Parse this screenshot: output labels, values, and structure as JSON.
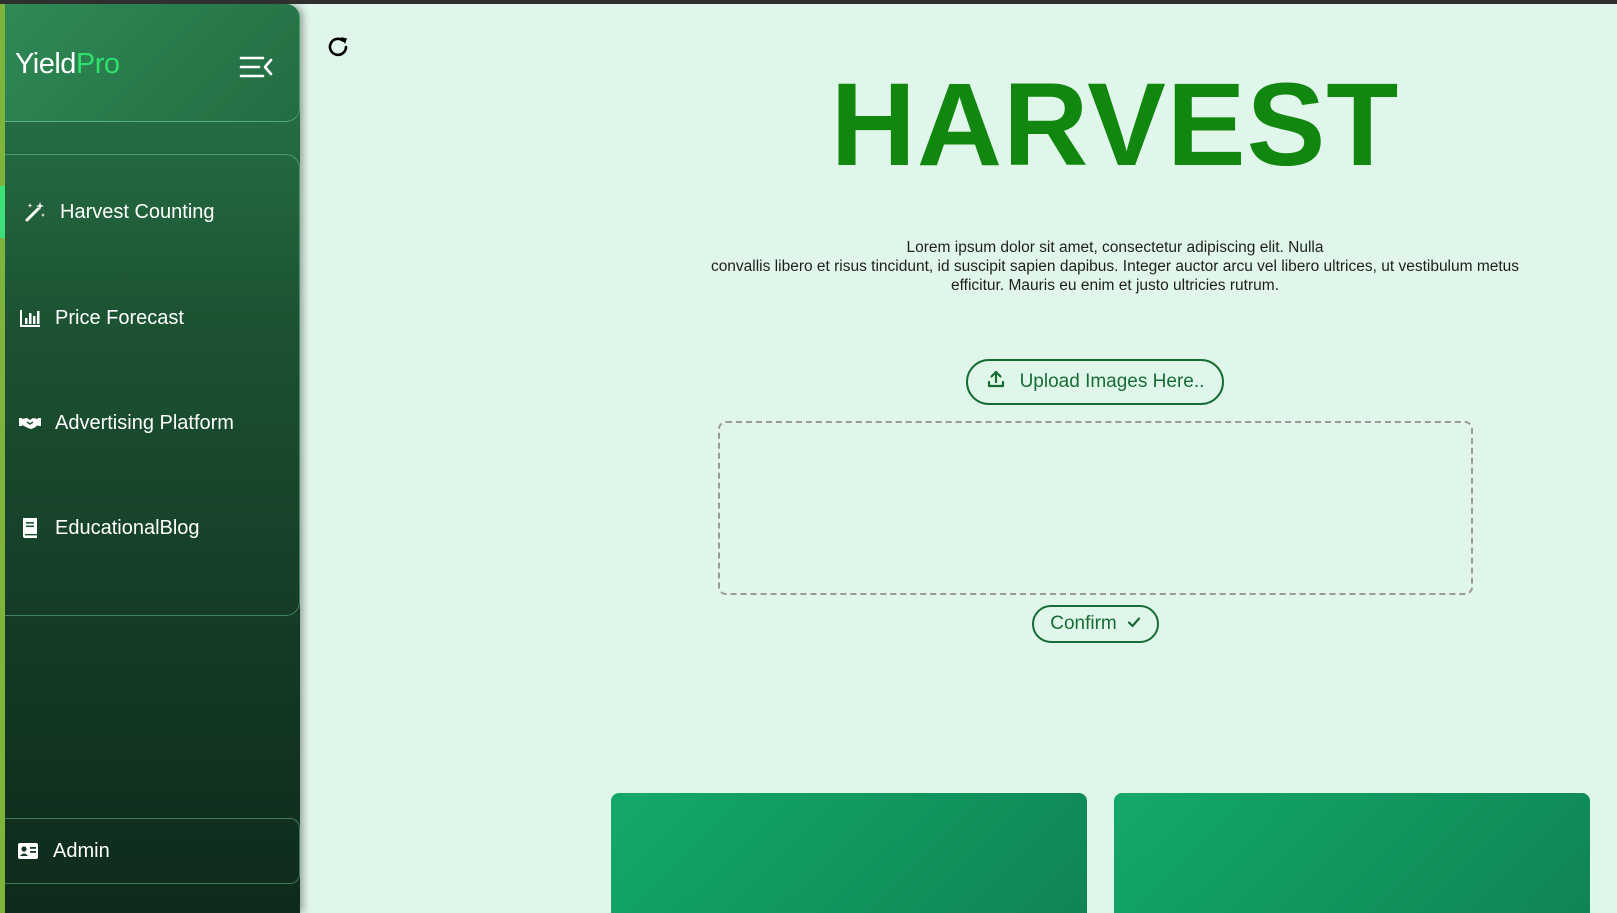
{
  "brand": {
    "name": "Yield",
    "accent": "Pro"
  },
  "sidebar": {
    "items": [
      {
        "label": "Harvest Counting",
        "icon": "magic-wand-icon",
        "active": true
      },
      {
        "label": "Price Forecast",
        "icon": "bar-chart-icon",
        "active": false
      },
      {
        "label": "Advertising Platform",
        "icon": "handshake-icon",
        "active": false
      },
      {
        "label": "EducationalBlog",
        "icon": "book-icon",
        "active": false
      }
    ],
    "admin": {
      "label": "Admin",
      "icon": "id-card-icon"
    }
  },
  "main": {
    "title": "HARVEST",
    "description_lines": [
      "Lorem ipsum dolor sit amet, consectetur adipiscing elit. Nulla",
      "convallis libero et risus tincidunt, id suscipit sapien dapibus. Integer auctor arcu vel libero ultrices, ut vestibulum metus",
      "efficitur. Mauris eu enim et justo ultricies rutrum."
    ],
    "upload_label": "Upload Images Here..",
    "confirm_label": "Confirm"
  },
  "colors": {
    "title": "#12870f",
    "brand_accent": "#2fe06a",
    "button": "#156d34",
    "page_bg": "#e1f6ea",
    "card": "#13a96a"
  }
}
